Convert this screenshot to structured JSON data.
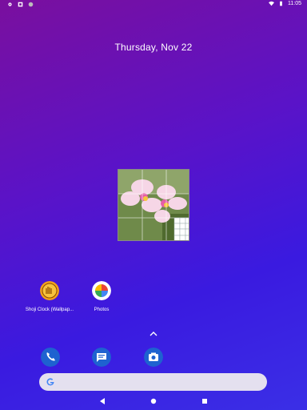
{
  "status_bar": {
    "time": "11:05",
    "left_icons": [
      "settings-icon",
      "notification-icon",
      "circle-icon"
    ],
    "right_icons": [
      "wifi-icon",
      "battery-icon"
    ]
  },
  "date": {
    "text": "Thursday, Nov 22"
  },
  "apps": [
    {
      "label": "Shoji Clock (Wallpap...",
      "icon": "shoji-clock-icon"
    },
    {
      "label": "Photos",
      "icon": "photos-icon"
    }
  ],
  "dock": [
    {
      "icon": "phone-icon"
    },
    {
      "icon": "messages-icon"
    },
    {
      "icon": "camera-icon"
    }
  ],
  "search": {
    "placeholder": ""
  },
  "nav": [
    "back-icon",
    "home-icon",
    "recents-icon"
  ],
  "colors": {
    "accent_blue": "#1e62d0",
    "search_bg": "#e4e0ef"
  }
}
